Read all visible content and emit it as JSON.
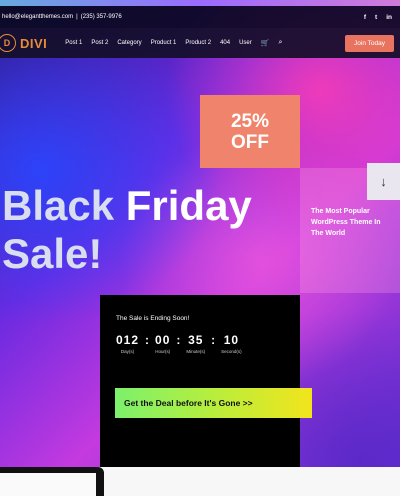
{
  "topbar": {
    "email": "hello@elegantthemes.com",
    "separator": "|",
    "phone": "(235) 357-9976",
    "social": [
      "f",
      "t",
      "in"
    ]
  },
  "nav": {
    "logo_mark": "D",
    "logo_text": "DIVI",
    "items": [
      "Post 1",
      "Post 2",
      "Category",
      "Product 1",
      "Product 2",
      "404",
      "User"
    ],
    "cart_icon": "🛒",
    "search_icon": "⌕",
    "join_label": "Join Today"
  },
  "hero": {
    "discount_line1": "25%",
    "discount_line2": "OFF",
    "headline_word1": "Black",
    "headline_word2": "Friday",
    "headline_line2": "Sale!",
    "side_text": "The Most Popular WordPress Theme In The World",
    "arrow": "↓"
  },
  "countdown": {
    "title": "The Sale is Ending Soon!",
    "units": [
      {
        "value": "012",
        "label": "Day(s)"
      },
      {
        "value": "00",
        "label": "Hour(s)"
      },
      {
        "value": "35",
        "label": "Minute(s)"
      },
      {
        "value": "10",
        "label": "Second(s)"
      }
    ],
    "separator": ":",
    "button_label": "Get the Deal before It's Gone  >>"
  },
  "colors": {
    "accent_orange": "#e58c38",
    "join_button": "#e8745f",
    "discount_box": "#f0836c"
  }
}
